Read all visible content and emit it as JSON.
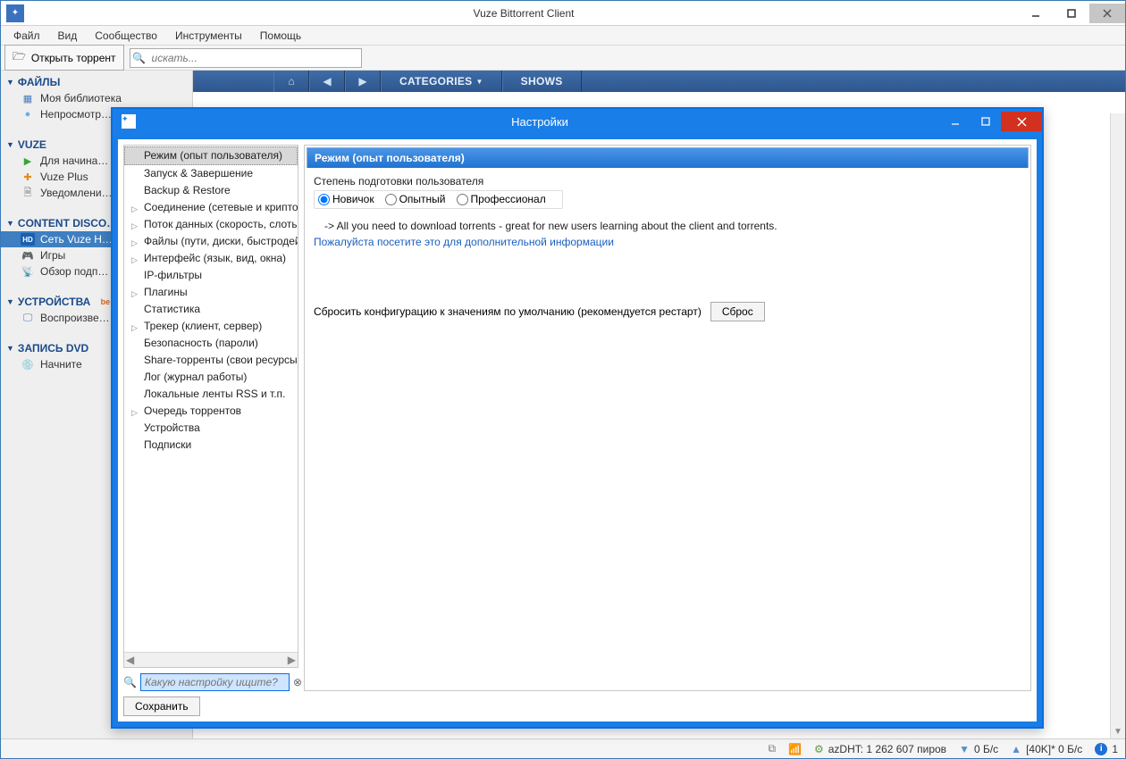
{
  "window": {
    "title": "Vuze Bittorrent Client"
  },
  "menu": {
    "file": "Файл",
    "view": "Вид",
    "community": "Сообщество",
    "tools": "Инструменты",
    "help": "Помощь"
  },
  "toolbar": {
    "open_torrent": "Открыть торрент",
    "search_placeholder": "искать..."
  },
  "nav": {
    "categories": "CATEGORIES",
    "shows": "SHOWS"
  },
  "sidebar": {
    "files_section": "ФАЙЛЫ",
    "library": "Моя библиотека",
    "unwatched": "Непросмотр…",
    "vuze_section": "VUZE",
    "getting_started": "Для начина…",
    "vuze_plus": "Vuze Plus",
    "notifications": "Уведомлени…",
    "content_section": "CONTENT DISCO…",
    "vuze_hd": "Сеть Vuze H…",
    "games": "Игры",
    "subscriptions": "Обзор подп…",
    "devices_section": "УСТРОЙСТВА",
    "devices_beta": "be",
    "play": "Воспроизве…",
    "dvd_section": "ЗАПИСЬ DVD",
    "start": "Начните"
  },
  "status": {
    "dht": "azDHT: 1 262 607 пиров",
    "down": "0 Б/с",
    "up": "[40K]* 0 Б/с",
    "friends": "1"
  },
  "dialog": {
    "title": "Настройки",
    "tree": {
      "mode": "Режим (опыт пользователя)",
      "startup": "Запуск & Завершение",
      "backup": "Backup & Restore",
      "connection": "Соединение (сетевые и крипто на…",
      "transfer": "Поток данных (скорость, слоты)",
      "files": "Файлы (пути, диски, быстродейс…",
      "interface": "Интерфейс (язык, вид, окна)",
      "ipfilters": "IP-фильтры",
      "plugins": "Плагины",
      "stats": "Статистика",
      "tracker": "Трекер (клиент, сервер)",
      "security": "Безопасность (пароли)",
      "sharing": "Share-торренты (свои ресурсы)",
      "logging": "Лог (журнал работы)",
      "rss": "Локальные ленты RSS и т.п.",
      "queue": "Очередь торрентов",
      "devices": "Устройства",
      "subscriptions": "Подписки"
    },
    "search_placeholder": "Какую настройку ищите?",
    "panel": {
      "heading": "Режим (опыт пользователя)",
      "legend": "Степень подготовки пользователя",
      "opt_beginner": "Новичок",
      "opt_intermediate": "Опытный",
      "opt_advanced": "Профессионал",
      "desc": "-> All you need to download torrents - great for new users learning about the client and torrents.",
      "link": "Пожалуйста посетите это для дополнительной информации",
      "reset_text": "Сбросить конфигурацию к значениям по умолчанию (рекомендуется рестарт)",
      "reset_btn": "Сброс"
    },
    "save": "Сохранить"
  }
}
